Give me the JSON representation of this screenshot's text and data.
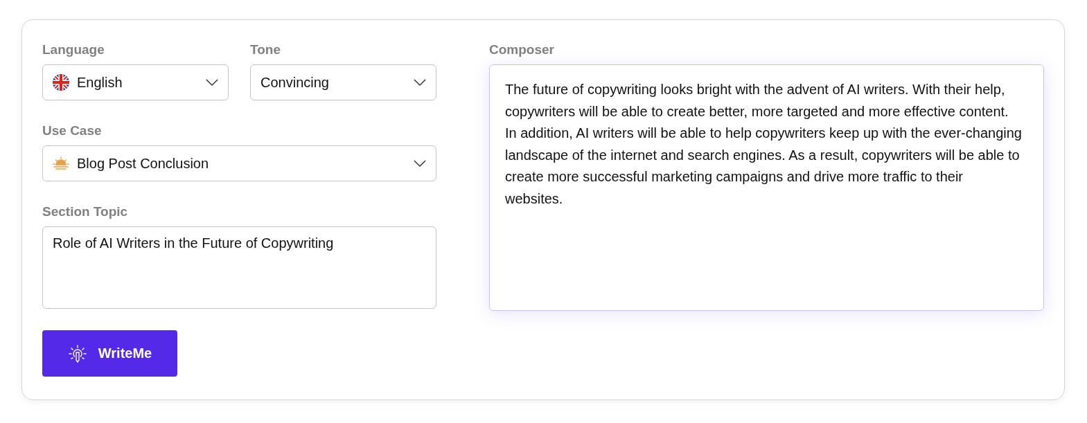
{
  "selects": [
    {
      "label": "Language",
      "value": "English",
      "kind": "flag"
    },
    {
      "label": "Tone",
      "value": "Convincing",
      "kind": "plain"
    },
    {
      "label": "Use Case",
      "value": "Blog Post Conclusion",
      "kind": "sunrise"
    }
  ],
  "topic": {
    "label": "Section Topic",
    "value": "Role of AI Writers in the Future of Copywriting"
  },
  "button": {
    "label": "WriteMe"
  },
  "composer": {
    "label": "Composer",
    "text": "The future of copywriting looks bright with the advent of AI writers. With their help, copywriters will be able to create better, more targeted and more effective content. In addition, AI writers will be able to help copywriters keep up with the ever-changing landscape of the internet and search engines. As a result, copywriters will be able to create more successful marketing campaigns and drive more traffic to their websites."
  }
}
